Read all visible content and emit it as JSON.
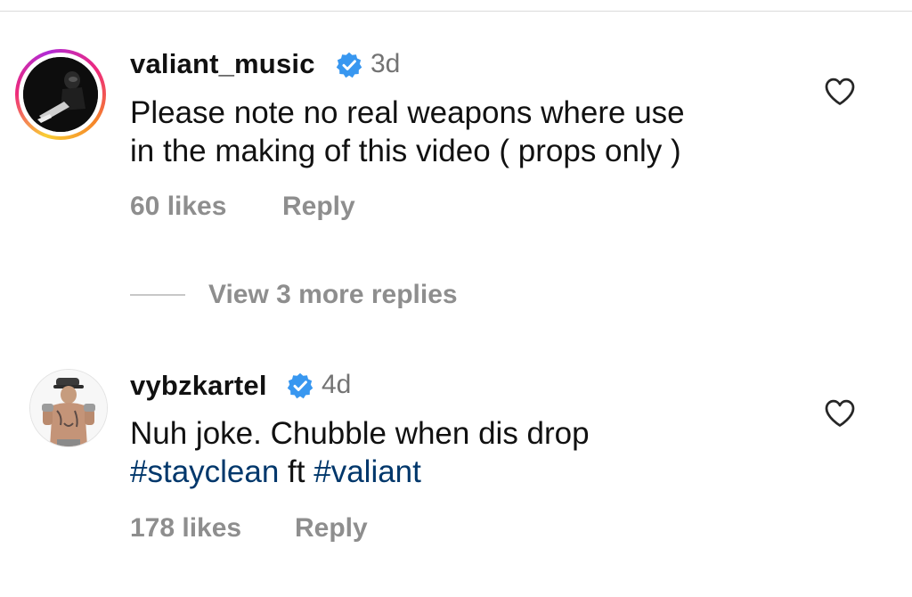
{
  "comments": [
    {
      "username": "valiant_music",
      "verified": true,
      "time": "3d",
      "text_line1": "Please note no real weapons where use",
      "text_line2": "in the making of this video ( props only )",
      "likes": "60 likes",
      "reply_label": "Reply",
      "story_ring": true
    },
    {
      "username": "vybzkartel",
      "verified": true,
      "time": "4d",
      "text_line1": "Nuh joke.  Chubble when dis drop",
      "hashtag1": "#stayclean",
      "text_mid": " ft ",
      "hashtag2": "#valiant",
      "likes": "178 likes",
      "reply_label": "Reply",
      "story_ring": false
    }
  ],
  "view_replies": "View 3 more replies",
  "colors": {
    "verified_badge": "#3897f0",
    "hashtag": "#00376b",
    "muted_text": "#8e8e8e",
    "story_ring_gradient": [
      "#f9ce34",
      "#ee2a7b",
      "#6228d7"
    ]
  },
  "icons": [
    "verified-badge-icon",
    "heart-outline-icon"
  ]
}
